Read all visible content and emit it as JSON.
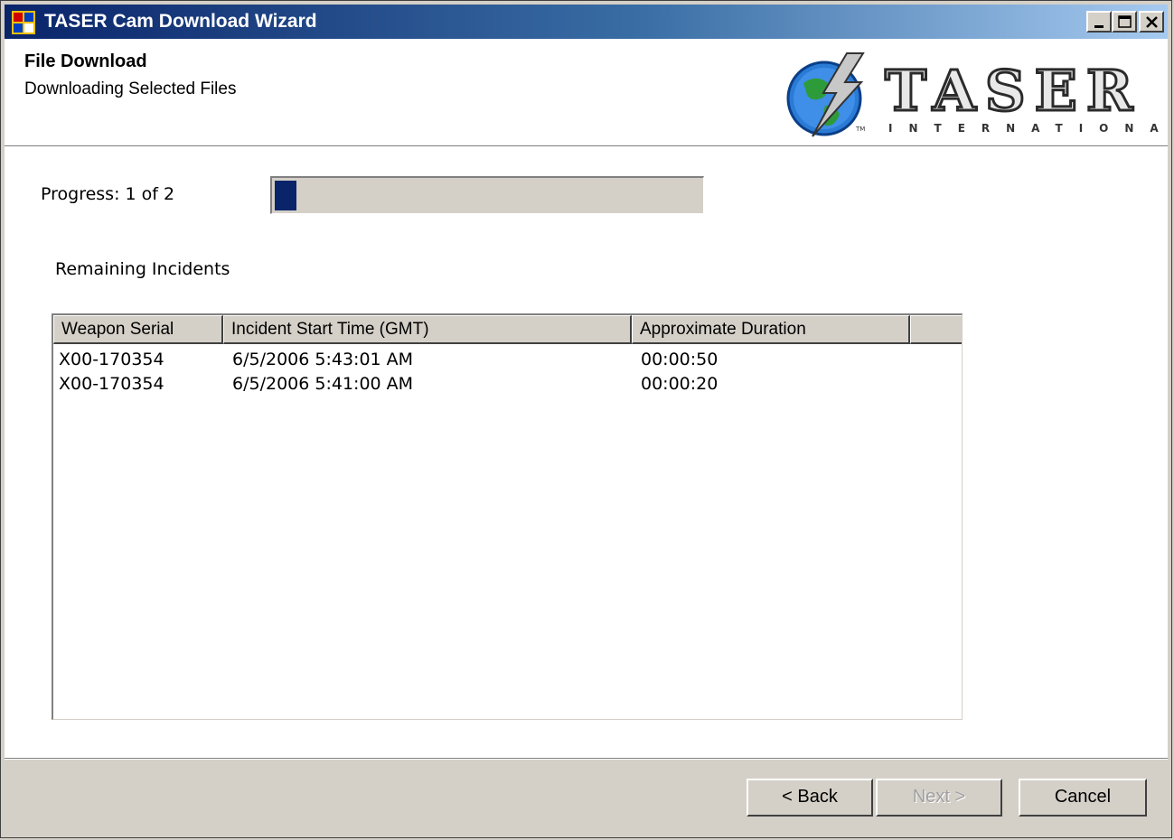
{
  "window": {
    "title": "TASER Cam Download Wizard",
    "icon": "app-icon",
    "controls": {
      "minimize_icon": "minimize-icon",
      "maximize_icon": "maximize-icon",
      "close_icon": "close-icon"
    }
  },
  "header": {
    "title": "File Download",
    "subtitle": "Downloading Selected Files",
    "logo": {
      "word": "TASER",
      "sub": "INTERNATIONAL",
      "tm": "TM",
      "icon": "taser-globe-logo"
    }
  },
  "progress": {
    "label": "Progress: 1 of 2",
    "fraction": 0.05,
    "color": "#0a246a"
  },
  "incidents": {
    "label": "Remaining Incidents",
    "columns": [
      "Weapon Serial",
      "Incident Start Time (GMT)",
      "Approximate Duration"
    ],
    "rows": [
      [
        "X00-170354",
        "6/5/2006 5:43:01 AM",
        "00:00:50"
      ],
      [
        "X00-170354",
        "6/5/2006 5:41:00 AM",
        "00:00:20"
      ]
    ]
  },
  "buttons": {
    "back": "< Back",
    "next": "Next >",
    "cancel": "Cancel"
  },
  "colors": {
    "title_bar_start": "#0a246a",
    "title_bar_end": "#a6caf0",
    "face": "#d4d0c8"
  }
}
